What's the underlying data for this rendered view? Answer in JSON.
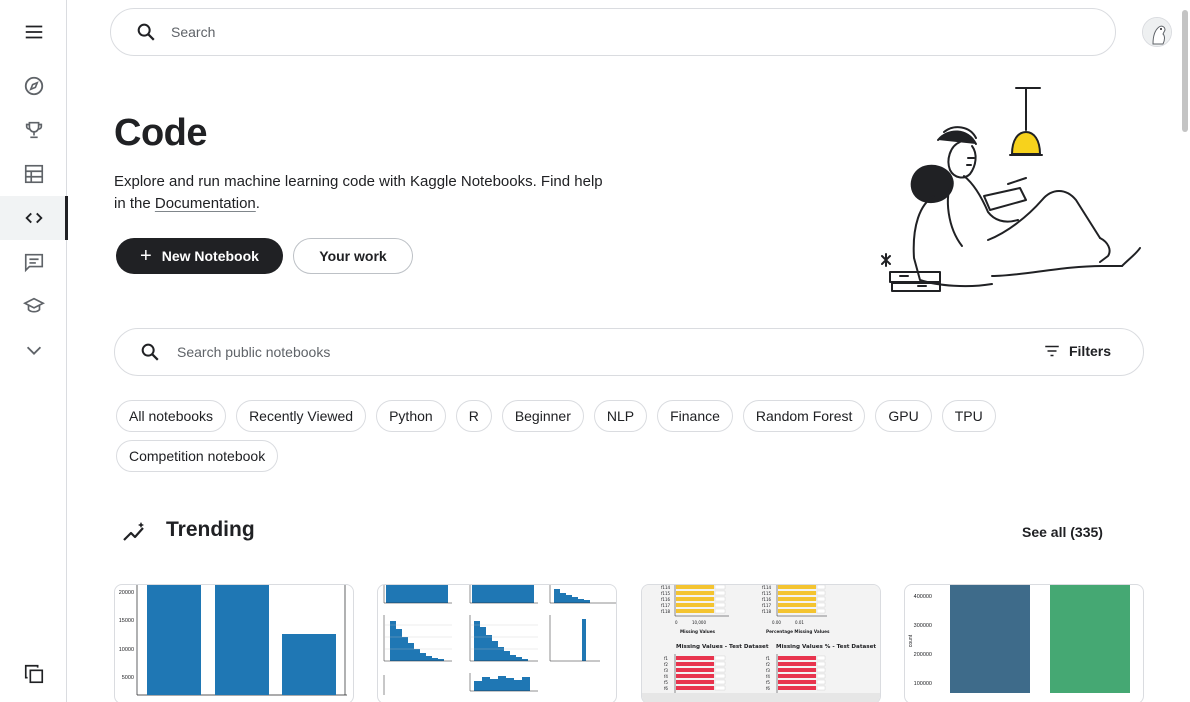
{
  "search": {
    "placeholder": "Search"
  },
  "sidebar": {
    "items": [
      {
        "name": "menu",
        "icon": "menu-icon"
      },
      {
        "name": "explore",
        "icon": "compass-icon"
      },
      {
        "name": "competitions",
        "icon": "trophy-icon"
      },
      {
        "name": "datasets",
        "icon": "table-icon"
      },
      {
        "name": "code",
        "icon": "code-icon",
        "active": true
      },
      {
        "name": "discussions",
        "icon": "comment-icon"
      },
      {
        "name": "learn",
        "icon": "school-icon"
      },
      {
        "name": "more",
        "icon": "chevron-down-icon"
      },
      {
        "name": "copy",
        "icon": "copy-icon"
      }
    ]
  },
  "hero": {
    "title": "Code",
    "description_prefix": "Explore and run machine learning code with Kaggle Notebooks. Find help in the ",
    "doc_link": "Documentation",
    "description_suffix": ".",
    "new_notebook": "New Notebook",
    "your_work": "Your work"
  },
  "notebook_search": {
    "placeholder": "Search public notebooks",
    "filters": "Filters"
  },
  "chips": [
    "All notebooks",
    "Recently Viewed",
    "Python",
    "R",
    "Beginner",
    "NLP",
    "Finance",
    "Random Forest",
    "GPU",
    "TPU",
    "Competition notebook"
  ],
  "trending": {
    "title": "Trending",
    "see_all": "See all (335)"
  },
  "cards": [
    {
      "ticks": [
        "20000",
        "15000",
        "10000",
        "5000"
      ]
    },
    {
      "labels": [
        "",
        "",
        ""
      ]
    },
    {
      "rows_top": [
        "f114",
        "f115",
        "f116",
        "f117",
        "f118"
      ],
      "left_axis": [
        "0",
        "10,000"
      ],
      "right_axis": [
        "0.00",
        "0.01"
      ],
      "left_caption": "Missing Values",
      "right_caption": "Percentage Missing Values",
      "left_title": "Missing Values - Test Dataset",
      "right_title": "Missing Values % - Test Dataset",
      "rows_bottom": [
        "f1",
        "f2",
        "f3",
        "f4",
        "f5",
        "f6"
      ]
    },
    {
      "ticks": [
        "400000",
        "300000",
        "200000",
        "100000"
      ],
      "ylabel": "count"
    }
  ],
  "colors": {
    "accent": "#202124",
    "bar_blue": "#1f77b4",
    "bar_yellow": "#f4c430",
    "bar_red": "#e8344e",
    "bar_teal": "#3e6b8a",
    "bar_green": "#45a873"
  }
}
